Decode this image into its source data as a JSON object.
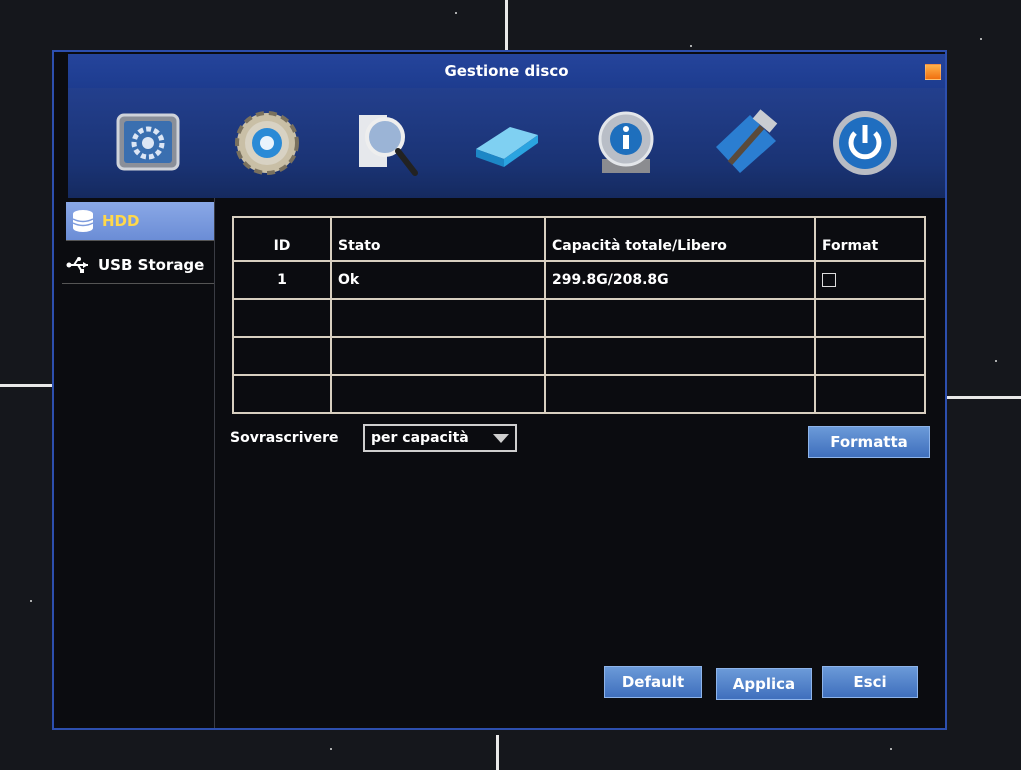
{
  "window": {
    "title": "Gestione disco"
  },
  "toolbar": {
    "icons": [
      "system-settings-icon",
      "config-gear-icon",
      "search-icon",
      "hdd-icon",
      "info-icon",
      "tools-icon",
      "power-icon"
    ]
  },
  "sidebar": {
    "items": [
      {
        "label": "HDD",
        "icon": "database-icon",
        "active": true
      },
      {
        "label": "USB Storage",
        "icon": "usb-icon",
        "active": false
      }
    ]
  },
  "disk_table": {
    "headers": {
      "id": "ID",
      "stato": "Stato",
      "capacita": "Capacità totale/Libero",
      "format": "Format"
    },
    "rows": [
      {
        "id": "1",
        "stato": "Ok",
        "capacita": "299.8G/208.8G",
        "format_checked": false
      },
      {
        "id": "",
        "stato": "",
        "capacita": ""
      },
      {
        "id": "",
        "stato": "",
        "capacita": ""
      },
      {
        "id": "",
        "stato": "",
        "capacita": ""
      }
    ]
  },
  "overwrite": {
    "label": "Sovrascrivere",
    "value": "per capacità"
  },
  "buttons": {
    "format": "Formatta",
    "default": "Default",
    "apply": "Applica",
    "exit": "Esci"
  },
  "colors": {
    "window_bg": "#0b0c10",
    "title_bar": "#1d3c8f",
    "button": "#4f7fc9",
    "active_item_text": "#ffd84a"
  }
}
